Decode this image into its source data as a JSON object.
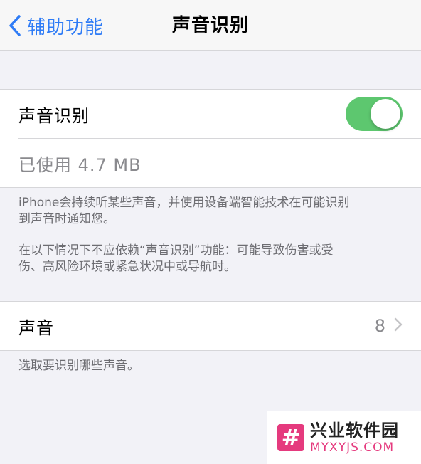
{
  "nav": {
    "back_label": "辅助功能",
    "title": "声音识别"
  },
  "main_toggle": {
    "label": "声音识别",
    "on": true
  },
  "storage": {
    "label": "已使用 4.7 MB"
  },
  "description": {
    "paragraph1_line1": "iPhone会持续听某些声音，并使用设备端智能技术在可能识别",
    "paragraph1_line2": "到声音时通知您。",
    "paragraph2_line1": "在以下情况下不应依赖“声音识别”功能：可能导致伤害或受",
    "paragraph2_line2": "伤、高风险环境或紧急状况中或导航时。"
  },
  "sounds_row": {
    "label": "声音",
    "count": "8"
  },
  "sounds_footer": "选取要识别哪些声音。",
  "watermark": {
    "logo_char": "#",
    "name_cn": "兴业软件园",
    "name_en": "MYXYJS.COM"
  },
  "colors": {
    "accent": "#2f7cf6",
    "toggle_on": "#5dc76f",
    "watermark": "#e53a7e"
  }
}
